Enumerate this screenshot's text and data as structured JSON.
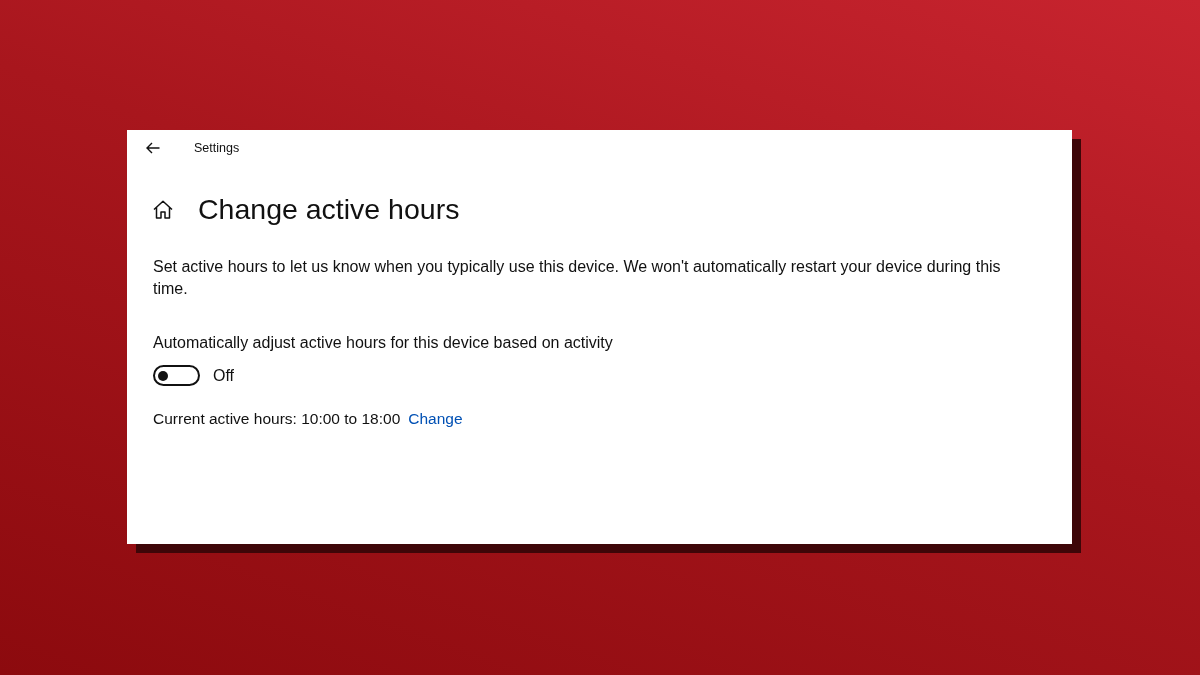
{
  "window": {
    "title": "Settings"
  },
  "page": {
    "title": "Change active hours",
    "description": "Set active hours to let us know when you typically use this device. We won't automatically restart your device during this time.",
    "auto_adjust": {
      "label": "Automatically adjust active hours for this device based on activity",
      "on": false,
      "state_text": "Off"
    },
    "current_hours": {
      "text": "Current active hours: 10:00 to 18:00",
      "link": "Change"
    }
  }
}
